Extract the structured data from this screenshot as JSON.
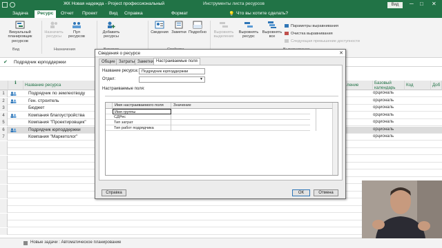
{
  "titlebar": {
    "file_title": "ЖК Новая надежда - Project профессиональный",
    "tool_context": "Инструменты листа ресурсов",
    "video_button": "Вид",
    "minimize": "─",
    "restore": "□",
    "close": "✕"
  },
  "tabs": [
    "Задача",
    "Ресурс",
    "Отчет",
    "Проект",
    "Вид",
    "Справка",
    "Формат"
  ],
  "tell_me": "Что вы хотите сделать?",
  "ribbon": {
    "view_group": {
      "btn": [
        "Визуальный",
        "планировщик ресурсов"
      ],
      "label": "Вид"
    },
    "assign_group": {
      "assign_btn": [
        "Назначить",
        "ресурсы"
      ],
      "pool_btn": [
        "Пул",
        "ресурсов"
      ],
      "label": "Назначения"
    },
    "insert_group": {
      "add_btn": [
        "Добавить",
        "ресурсы"
      ],
      "label": "Вставить"
    },
    "props_group": {
      "info_btn": "Сведения",
      "notes_btn": "Заметки",
      "details_btn": "Подробно",
      "label": "Свойства"
    },
    "level_group": {
      "level_sel_btn": [
        "Выровнять",
        "выделение"
      ],
      "level_res_btn": [
        "Выровнять",
        "ресурс"
      ],
      "level_all_btn": [
        "Выровнять",
        "все"
      ],
      "options": "Параметры выравнивания",
      "clear": "Очистка выравнивания",
      "next": "Следующая превышение доступности",
      "label": "Выравнивание"
    }
  },
  "entry_value": "Подрядчик юрподдержки",
  "columns": {
    "info": "ℹ",
    "name": "Название ресурса",
    "level": "ление",
    "calendar": [
      "Базовый",
      "календарь"
    ],
    "code": "Код",
    "add": "Доб"
  },
  "rows": [
    {
      "num": "1",
      "name": "Подрядчик по землеотводу",
      "icon": true,
      "right": "орциональ"
    },
    {
      "num": "2",
      "name": "Ген. строитель",
      "icon": true,
      "right": "орциональ"
    },
    {
      "num": "3",
      "name": "Бюджет",
      "icon": false,
      "right": "орциональ"
    },
    {
      "num": "4",
      "name": "Компания благоустройства",
      "icon": true,
      "right": "орциональ"
    },
    {
      "num": "5",
      "name": "Компания \"Проектировщик\"",
      "icon": false,
      "right": "орциональ"
    },
    {
      "num": "6",
      "name": "Подрядчик юрподдержки",
      "icon": true,
      "right": "орциональ",
      "selected": true
    },
    {
      "num": "7",
      "name": "Компания \"Маркетолог\"",
      "icon": false,
      "right": "орциональ"
    }
  ],
  "statusbar": {
    "text": "Новые задачи : Автоматическое планирование"
  },
  "dialog": {
    "title": "Сведения о ресурсе",
    "close": "✕",
    "tabs": [
      "Общие",
      "Затраты",
      "Заметки",
      "Настраиваемые поля"
    ],
    "name_label": "Название ресурса:",
    "name_value": "Подрядчик юрподдержки",
    "dept_label": "Отдел:",
    "dept_value": "",
    "cf_label": "Настраиваемые поля:",
    "cf_headers": [
      "Имя настраиваемого поля",
      "Значение"
    ],
    "cf_rows": [
      "Имя группы",
      "СДРес",
      "Тип затрат",
      "Тип работ подрядчика"
    ],
    "help_btn": "Справка",
    "ok_btn": "ОК",
    "cancel_btn": "Отмена"
  },
  "colors": {
    "brand": "#217346",
    "dialog_bg": "#ececec"
  }
}
